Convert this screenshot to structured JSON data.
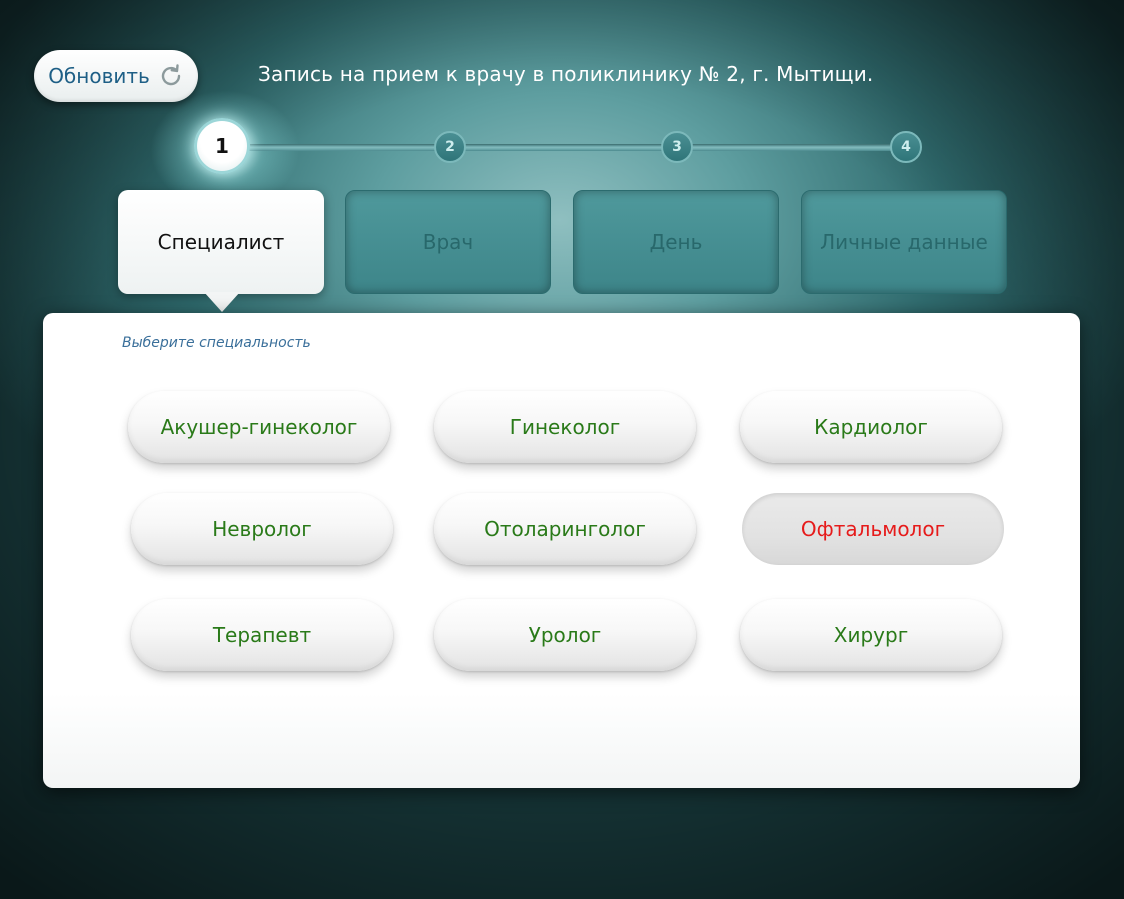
{
  "header": {
    "refresh_label": "Обновить",
    "refresh_icon": "refresh-icon",
    "title": "Запись на прием к врачу в поликлинику № 2, г. Мытищи."
  },
  "steps": [
    {
      "number": "1",
      "active": true
    },
    {
      "number": "2",
      "active": false
    },
    {
      "number": "3",
      "active": false
    },
    {
      "number": "4",
      "active": false
    }
  ],
  "tabs": [
    {
      "label": "Специалист",
      "active": true
    },
    {
      "label": "Врач",
      "active": false
    },
    {
      "label": "День",
      "active": false
    },
    {
      "label": "Личные данные",
      "active": false
    }
  ],
  "panel": {
    "hint": "Выберите специальность",
    "specialties": [
      {
        "label": "Акушер-гинеколог",
        "selected": false
      },
      {
        "label": "Гинеколог",
        "selected": false
      },
      {
        "label": "Кардиолог",
        "selected": false
      },
      {
        "label": "Невролог",
        "selected": false
      },
      {
        "label": "Отоларинголог",
        "selected": false
      },
      {
        "label": "Офтальмолог",
        "selected": true
      },
      {
        "label": "Терапевт",
        "selected": false
      },
      {
        "label": "Уролог",
        "selected": false
      },
      {
        "label": "Хирург",
        "selected": false
      }
    ]
  },
  "colors": {
    "specialty_text": "#2a7a19",
    "specialty_selected_text": "#e61b1b",
    "accent_teal": "#3d8589",
    "refresh_text": "#1e5f86"
  }
}
